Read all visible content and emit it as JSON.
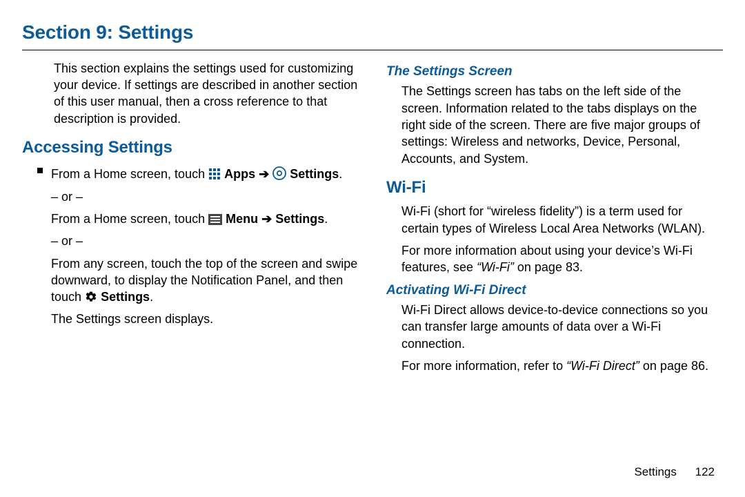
{
  "header": {
    "title": "Section 9: Settings"
  },
  "left": {
    "intro": "This section explains the settings used for customizing your device. If settings are described in another section of this user manual, then a cross reference to that description is provided.",
    "h2": "Accessing Settings",
    "line1_a": "From a Home screen, touch ",
    "apps": "Apps",
    "arrow": "➔",
    "settings": "Settings",
    "period": ".",
    "or": "– or –",
    "line2_a": "From a Home screen, touch ",
    "menu": "Menu",
    "line3": "From any screen, touch the top of the screen and swipe downward, to display the Notification Panel, and then touch ",
    "line4": "The Settings screen displays."
  },
  "right": {
    "h3a": "The Settings Screen",
    "p1": "The Settings screen has tabs on the left side of the screen. Information related to the tabs displays on the right side of the screen. There are five major groups of settings: Wireless and networks, Device, Personal, Accounts, and System.",
    "h2": "Wi-Fi",
    "p2": "Wi-Fi (short for “wireless fidelity”) is a term used for certain types of Wireless Local Area Networks (WLAN).",
    "p3a": "For more information about using your device’s Wi-Fi features, see ",
    "p3b": "“Wi-Fi”",
    "p3c": " on page 83.",
    "h3b": "Activating Wi-Fi Direct",
    "p4": "Wi-Fi Direct allows device-to-device connections so you can transfer large amounts of data over a Wi-Fi connection.",
    "p5a": "For more information, refer to ",
    "p5b": "“Wi-Fi Direct”",
    "p5c": " on page 86."
  },
  "footer": {
    "label": "Settings",
    "page": "122"
  }
}
